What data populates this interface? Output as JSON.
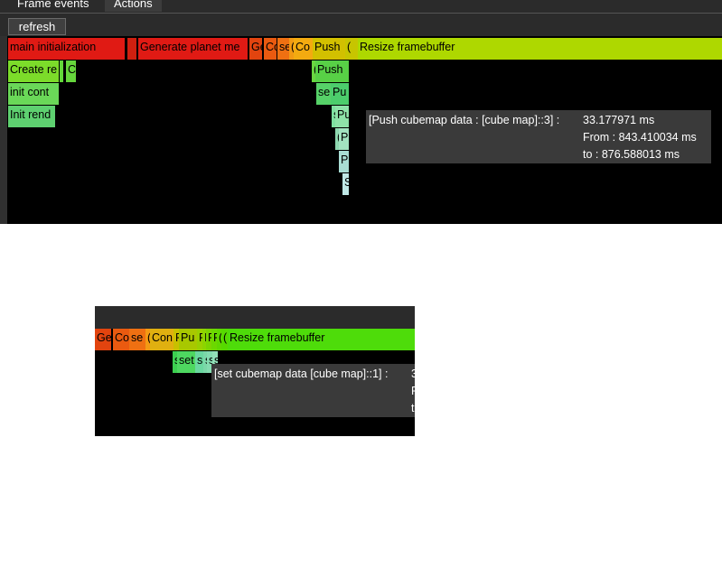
{
  "tabs": [
    {
      "label": "Frame events"
    },
    {
      "label": "Actions"
    }
  ],
  "refresh_label": "refresh",
  "main": {
    "row1": [
      {
        "label": "main initialization",
        "color": "#e01a14"
      },
      {
        "label": "",
        "color": "#cf2010"
      },
      {
        "label": "Generate planet me",
        "color": "#e01a14"
      },
      {
        "label": "Ge",
        "color": "#e2440f"
      },
      {
        "label": "Co",
        "color": "#ea5a10"
      },
      {
        "label": "se",
        "color": "#ef7012"
      },
      {
        "label": "(",
        "color": "#f39a13"
      },
      {
        "label": "Co",
        "color": "#f3aa10"
      },
      {
        "label": "Push",
        "color": "#d2c000"
      },
      {
        "label": "(",
        "color": "#c7c500"
      },
      {
        "label": "Resize framebuffer",
        "color": "#aed800"
      }
    ],
    "row2": [
      {
        "label": "Create re",
        "color": "#7cdc2a"
      },
      {
        "label": "",
        "color": "#62d83a"
      },
      {
        "label": "C",
        "color": "#66d63c"
      },
      {
        "label": "(",
        "color": "#69d640"
      },
      {
        "label": "Push",
        "color": "#58d046"
      }
    ],
    "row3": [
      {
        "label": "init cont",
        "color": "#6ad858"
      },
      {
        "label": "se",
        "color": "#56d168"
      },
      {
        "label": "Pu",
        "color": "#4ccd6c"
      }
    ],
    "row4": [
      {
        "label": "Init rend",
        "color": "#5ed070"
      },
      {
        "label": "s",
        "color": "#7fe0a0"
      },
      {
        "label": "Pu",
        "color": "#8ee2a8"
      }
    ],
    "row5": [
      {
        "label": "(",
        "color": "#8ed8b0"
      },
      {
        "label": "P",
        "color": "#a2e4c0"
      }
    ],
    "row6": [
      {
        "label": "P",
        "color": "#a8ddd4"
      }
    ],
    "row7": [
      {
        "label": "S",
        "color": "#bfe8e6"
      }
    ],
    "tooltip": {
      "name": "[Push cubemap data : [cube map]::3] :",
      "duration": "33.177971 ms",
      "from": "From : 843.410034 ms",
      "to": "to : 876.588013 ms"
    }
  },
  "second": {
    "row1": [
      {
        "label": "Ge",
        "color": "#e2440f"
      },
      {
        "label": "Co",
        "color": "#ea5a10"
      },
      {
        "label": "se",
        "color": "#ef7012"
      },
      {
        "label": "(",
        "color": "#f39a13"
      },
      {
        "label": "Con",
        "color": "#e0b010"
      },
      {
        "label": "F",
        "color": "#c8c000"
      },
      {
        "label": "Pu",
        "color": "#a8c800"
      },
      {
        "label": "F",
        "color": "#9ad000"
      },
      {
        "label": "I",
        "color": "#8cd400"
      },
      {
        "label": "F",
        "color": "#7cd400"
      },
      {
        "label": "F",
        "color": "#6cd800"
      },
      {
        "label": "(",
        "color": "#60d800"
      },
      {
        "label": "(",
        "color": "#56da00"
      },
      {
        "label": "Resize framebuffer",
        "color": "#4edc0a"
      }
    ],
    "row2": [
      {
        "label": "s",
        "color": "#3cd050"
      },
      {
        "label": "set",
        "color": "#4ed860"
      },
      {
        "label": "s",
        "color": "#6ad8a0"
      },
      {
        "label": "s",
        "color": "#7ad8a8"
      },
      {
        "label": "s",
        "color": "#84dcb0"
      },
      {
        "label": "s",
        "color": "#92e0b8"
      }
    ],
    "tooltip": {
      "name": "[set cubemap data [cube map]::1] :",
      "duration": "3",
      "from": "F",
      "to": "t"
    }
  }
}
